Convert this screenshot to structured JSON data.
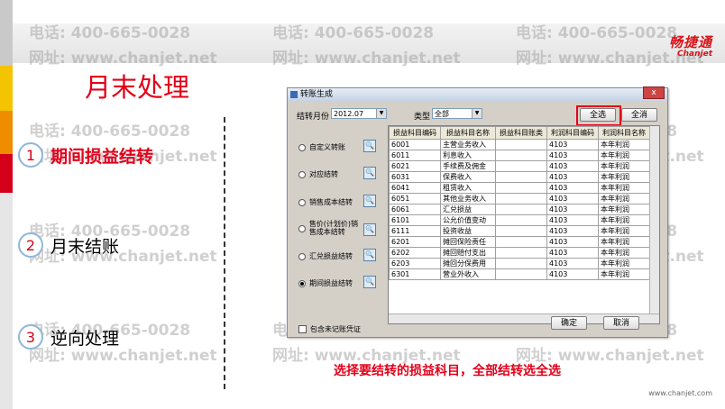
{
  "watermark": {
    "phone": "电话: 400-665-0028",
    "web": "网址: www.chanjet.net"
  },
  "brand": {
    "name_cn": "畅捷通",
    "name_en": "Chanjet"
  },
  "page_title": "月末处理",
  "menu": [
    {
      "num": "1",
      "label": "期间损益结转"
    },
    {
      "num": "2",
      "label": "月末结账"
    },
    {
      "num": "3",
      "label": "逆向处理"
    }
  ],
  "dialog": {
    "title": "转账生成",
    "close": "x",
    "month_label": "结转月份",
    "month_value": "2012.07",
    "type_label": "类型",
    "type_value": "全部",
    "select_all": "全选",
    "clear_all": "全消",
    "options": [
      {
        "label": "自定义转账",
        "selected": false
      },
      {
        "label": "对应结转",
        "selected": false
      },
      {
        "label": "销售成本结转",
        "selected": false
      },
      {
        "label": "售价(计划价)销售成本结转",
        "selected": false
      },
      {
        "label": "汇兑损益结转",
        "selected": false
      },
      {
        "label": "期间损益结转",
        "selected": true
      }
    ],
    "search_icon_glyph": "🔍",
    "include_unposted": "包含未记账凭证",
    "ok": "确定",
    "cancel": "取消",
    "columns": [
      "损益科目编码",
      "损益科目名称",
      "损益科目账类",
      "利润科目编码",
      "利润科目名称"
    ],
    "rows": [
      [
        "6001",
        "主营业务收入",
        "",
        "4103",
        "本年利润"
      ],
      [
        "6011",
        "利息收入",
        "",
        "4103",
        "本年利润"
      ],
      [
        "6021",
        "手续费及佣金",
        "",
        "4103",
        "本年利润"
      ],
      [
        "6031",
        "保费收入",
        "",
        "4103",
        "本年利润"
      ],
      [
        "6041",
        "租赁收入",
        "",
        "4103",
        "本年利润"
      ],
      [
        "6051",
        "其他业务收入",
        "",
        "4103",
        "本年利润"
      ],
      [
        "6061",
        "汇兑损益",
        "",
        "4103",
        "本年利润"
      ],
      [
        "6101",
        "公允价值变动",
        "",
        "4103",
        "本年利润"
      ],
      [
        "6111",
        "投资收益",
        "",
        "4103",
        "本年利润"
      ],
      [
        "6201",
        "摊回保险责任",
        "",
        "4103",
        "本年利润"
      ],
      [
        "6202",
        "摊回赔付支出",
        "",
        "4103",
        "本年利润"
      ],
      [
        "6203",
        "摊回分保费用",
        "",
        "4103",
        "本年利润"
      ],
      [
        "6301",
        "营业外收入",
        "",
        "4103",
        "本年利润"
      ]
    ]
  },
  "caption": "选择要结转的损益科目，全部结转选全选",
  "footer_url": "www.chanjet.com"
}
